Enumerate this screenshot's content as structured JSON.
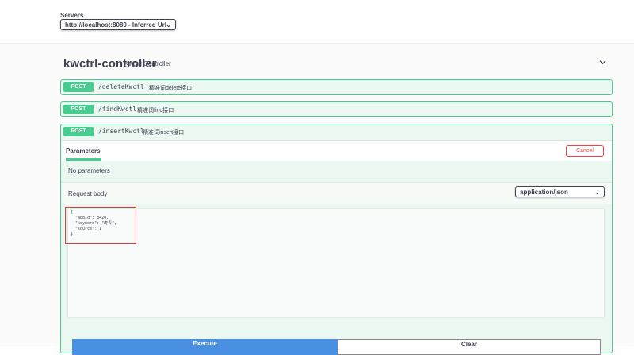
{
  "servers": {
    "label": "Servers",
    "selected": "http://localhost:8080 - Inferred Url"
  },
  "tag": {
    "name": "kwctrl-controller",
    "description": "Kwctrl Controller"
  },
  "operations": [
    {
      "method": "POST",
      "path": "/deleteKwctl",
      "summary": "精准词delete接口"
    },
    {
      "method": "POST",
      "path": "/findKwctl",
      "summary": "精准词find接口"
    },
    {
      "method": "POST",
      "path": "/insertKwctl",
      "summary": "精准词insert接口"
    }
  ],
  "expanded": {
    "params_tab": "Parameters",
    "cancel_label": "Cancel",
    "no_params": "No parameters",
    "request_body_label": "Request body",
    "content_type": "application/json",
    "json_body": "{\n  \"appId\": 8420,\n  \"keyword\": \"寿青\",\n  \"source\": 1\n}",
    "execute_label": "Execute",
    "clear_label": "Clear"
  },
  "colors": {
    "post_green": "#49cc90",
    "post_bg": "#ebf7f1",
    "cancel_red": "#f93e3e",
    "execute_blue": "#4990e2"
  }
}
